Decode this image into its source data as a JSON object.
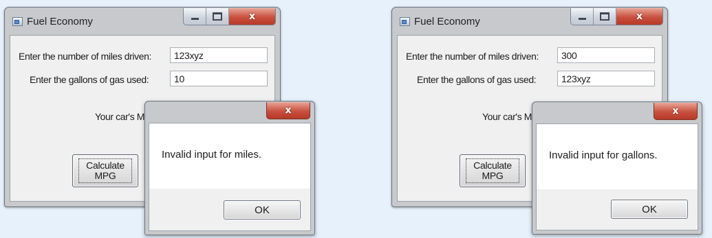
{
  "scenes": [
    {
      "window": {
        "title": "Fuel Economy",
        "miles_label": "Enter the number of miles driven:",
        "miles_value": "123xyz",
        "gallons_label": "Enter the gallons of gas used:",
        "gallons_value": "10",
        "mpg_label": "Your car's M",
        "calculate_line1": "Calculate",
        "calculate_line2": "MPG",
        "icons": {
          "app": "app-icon",
          "minimize": "minimize-icon",
          "maximize": "maximize-icon",
          "close": "close-icon"
        }
      },
      "message_box": {
        "message": "Invalid input for miles.",
        "ok_label": "OK",
        "close_glyph": "x"
      }
    },
    {
      "window": {
        "title": "Fuel Economy",
        "miles_label": "Enter the number of miles driven:",
        "miles_value": "300",
        "gallons_label": "Enter the gallons of gas used:",
        "gallons_value": "123xyz",
        "mpg_label": "Your car's M",
        "calculate_line1": "Calculate",
        "calculate_line2": "MPG",
        "icons": {
          "app": "app-icon",
          "minimize": "minimize-icon",
          "maximize": "maximize-icon",
          "close": "close-icon"
        }
      },
      "message_box": {
        "message": "Invalid input for gallons.",
        "ok_label": "OK",
        "close_glyph": "x"
      }
    }
  ],
  "colors": {
    "background": "#e6f1fb",
    "window_frame": "#c7c9cc",
    "client_area": "#f0f0f0",
    "close_button": "#c8503f"
  }
}
